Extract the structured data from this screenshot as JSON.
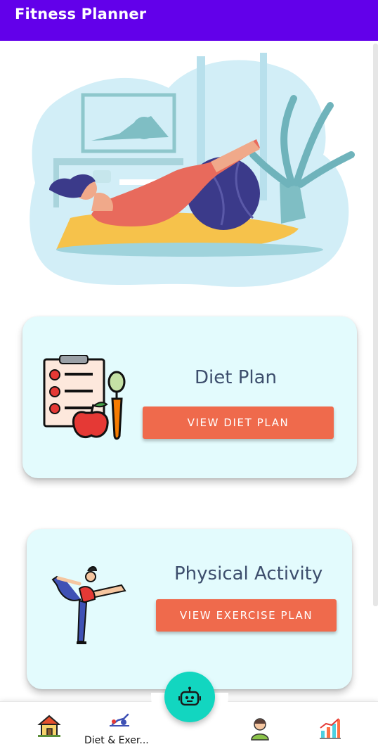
{
  "app": {
    "title": "Fitness Planner"
  },
  "cards": {
    "diet": {
      "title": "Diet Plan",
      "button_label": "VIEW DIET PLAN"
    },
    "activity": {
      "title": "Physical Activity",
      "button_label": "VIEW EXERCISE PLAN"
    }
  },
  "bottom_nav": {
    "items": [
      {
        "icon": "house-icon",
        "label": ""
      },
      {
        "icon": "exercise-icon",
        "label": "Diet & Exer..."
      },
      {
        "icon": "doctor-icon",
        "label": ""
      },
      {
        "icon": "bar-chart-icon",
        "label": ""
      }
    ],
    "fab_icon": "robot-icon"
  },
  "colors": {
    "app_bar": "#6200ea",
    "card_background": "#e3fbfd",
    "button": "#ef6a4c",
    "fab": "#12d6c0",
    "title_text": "#3d4e6d"
  }
}
